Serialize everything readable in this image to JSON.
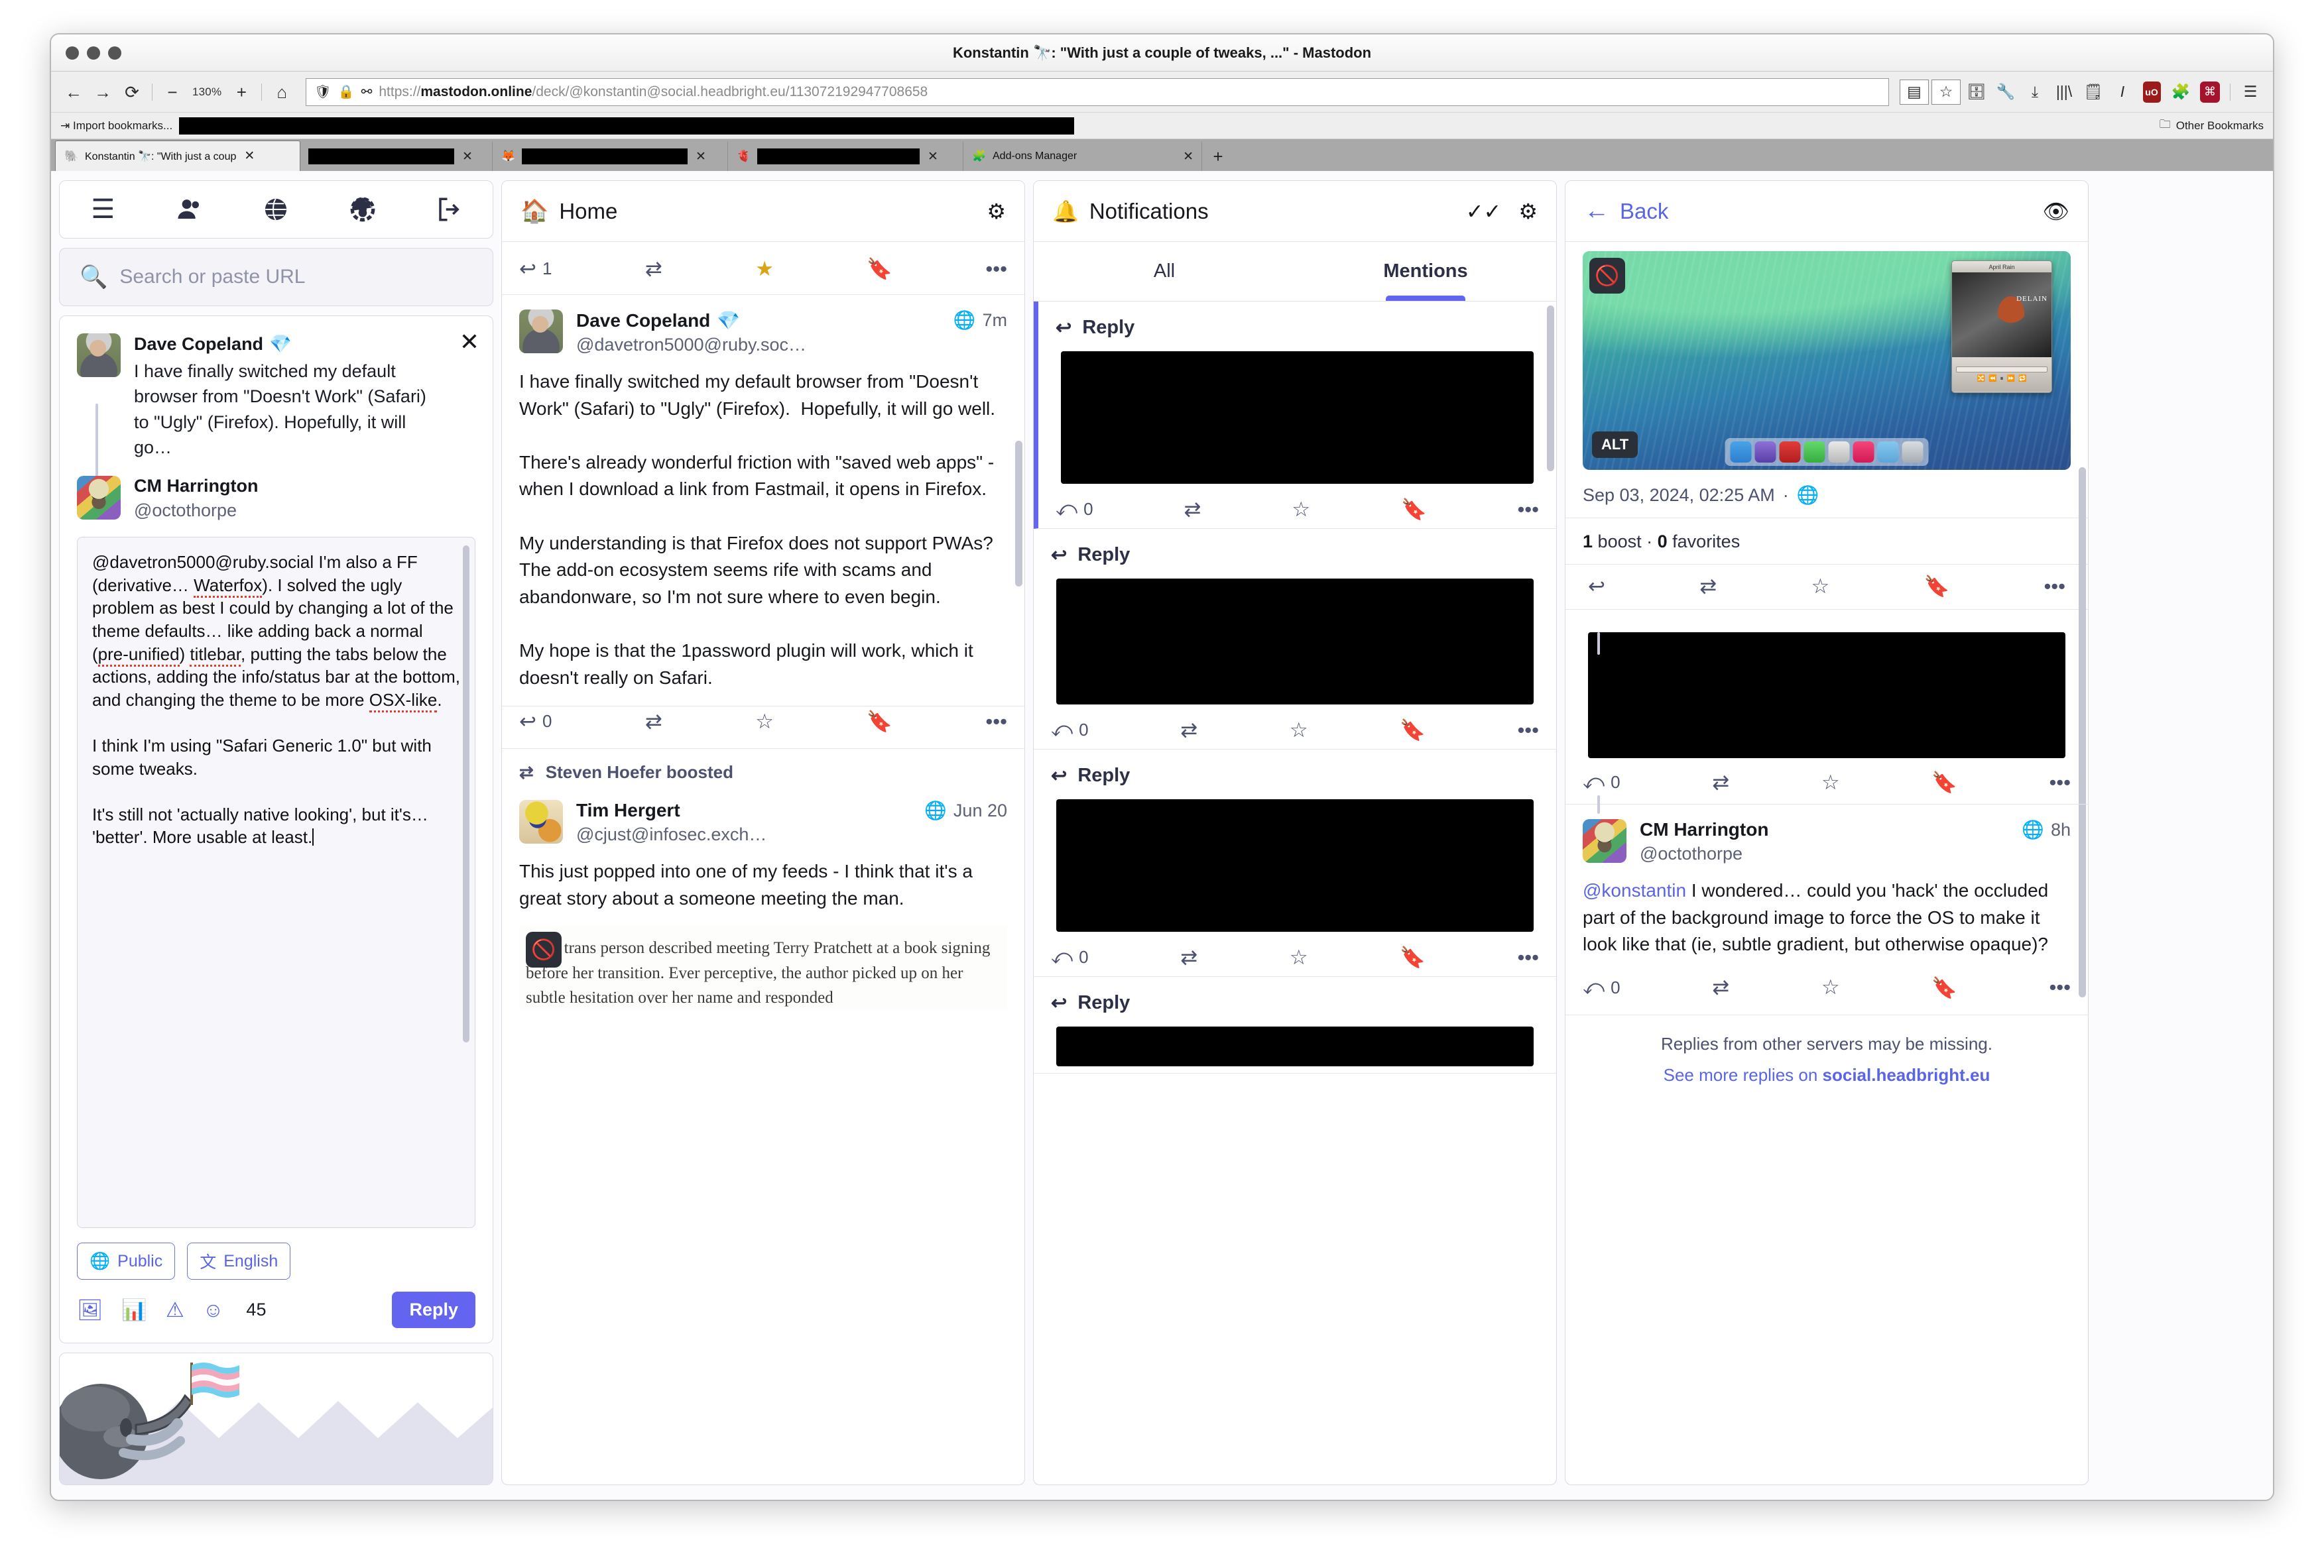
{
  "window": {
    "title": "Konstantin 🔭: \"With just a couple of tweaks, ...\" - Mastodon"
  },
  "browser": {
    "zoom": "130%",
    "url_scheme": "https://",
    "url_domain": "mastodon.online",
    "url_path": "/deck/@konstantin@social.headbright.eu/113072192947708658",
    "bookmarks_import": "Import bookmarks...",
    "other_bookmarks": "Other Bookmarks",
    "tabs": [
      {
        "label": "Konstantin 🔭: \"With just a coup",
        "favicon": "mastodon-icon",
        "active": true,
        "redacted": false
      },
      {
        "label": "",
        "favicon": "blank-icon",
        "active": false,
        "redacted": true
      },
      {
        "label": "",
        "favicon": "firefox-icon",
        "active": false,
        "redacted": true
      },
      {
        "label": "",
        "favicon": "heart-icon",
        "active": false,
        "redacted": true
      },
      {
        "label": "Add-ons Manager",
        "favicon": "addons-icon",
        "active": false,
        "redacted": false
      }
    ],
    "nav_icons": [
      "back-icon",
      "forward-icon",
      "reload-icon",
      "zoom-out-icon",
      "zoom-in-icon",
      "home-icon"
    ],
    "url_icons": [
      "shield-icon",
      "lock-icon",
      "permissions-icon"
    ],
    "toolbar_icons": [
      "reader-mode-icon",
      "bookmark-star-icon",
      "save-page-icon",
      "wrench-icon",
      "downloads-icon",
      "library-icon",
      "annotate-icon",
      "italic-icon",
      "ublock-origin-icon",
      "addons-icon",
      "command-key-icon",
      "app-menu-icon"
    ]
  },
  "sidebar": {
    "nav_icons": [
      "hamburger-menu-icon",
      "people-icon",
      "globe-icon",
      "gear-icon",
      "logout-icon"
    ],
    "search": {
      "placeholder": "Search or paste URL",
      "icon": "search-icon"
    },
    "thread_preview": [
      {
        "name": "Dave Copeland",
        "emoji": "💎",
        "handle": "",
        "body": "I have finally switched my default browser from \"Doesn't Work\" (Safari) to \"Ugly\" (Firefox).  Hopefully, it will go…",
        "avatar": "av-dave"
      },
      {
        "name": "CM Harrington",
        "emoji": "",
        "handle": "@octothorpe",
        "body": "",
        "avatar": "av-cm"
      }
    ],
    "close_label": "✕",
    "compose": {
      "text_part1": "@davetron5000@ruby.social I'm also a FF (derivative… ",
      "sp1": "Waterfox",
      "text_part2": "). I solved the ugly problem as best I could by changing a lot of the theme defaults… like adding back a normal (",
      "sp2": "pre-unified",
      "text_part3": ") ",
      "sp3": "titlebar",
      "text_part4": ", putting the tabs below the actions, adding the info/status bar at the bottom, and changing the theme to be more ",
      "sp4": "OSX-like",
      "text_part5": ".\n\nI think I'm using \"Safari Generic 1.0\" but with some tweaks.\n\nIt's still not 'actually native looking', but it's… 'better'. More usable at least.",
      "visibility": "Public",
      "visibility_icon": "globe-icon",
      "language": "English",
      "language_icon": "translate-icon",
      "action_icons": [
        "add-media-icon",
        "add-poll-icon",
        "content-warning-icon",
        "emoji-picker-icon"
      ],
      "char_count": "45",
      "submit_label": "Reply"
    }
  },
  "home_column": {
    "title": "Home",
    "title_icon": "home-icon",
    "settings_icon": "gear-icon",
    "pinned_actionbar": {
      "reply_count": "1",
      "icons": [
        "reply-icon",
        "boost-icon",
        "favourite-star-icon",
        "bookmark-icon",
        "more-icon"
      ],
      "favourited": true
    },
    "posts": [
      {
        "name": "Dave Copeland",
        "emoji": "💎",
        "handle": "@davetron5000@ruby.soc…",
        "time": "7m",
        "visibility_icon": "globe-icon",
        "avatar": "av-dave",
        "body": "I have finally switched my default browser from \"Doesn't Work\" (Safari) to \"Ugly\" (Firefox).  Hopefully, it will go well.\n\nThere's already wonderful friction with \"saved web apps\" - when I download a link from Fastmail, it opens in Firefox.\n\nMy understanding is that Firefox does not support PWAs?  The add-on ecosystem seems rife with scams and abandonware, so I'm not sure where to even begin.\n\nMy hope is that the 1password plugin will work, which it doesn't really on Safari.",
        "reply_count": "0",
        "boosted_by": null
      },
      {
        "name": "Tim Hergert",
        "emoji": "",
        "handle": "@cjust@infosec.exch…",
        "time": "Jun 20",
        "visibility_icon": "globe-icon",
        "avatar": "av-tim",
        "body": "This just popped into one of my feeds - I think that it's a great story about a someone meeting the man.",
        "reply_count": "",
        "boosted_by": "Steven Hoefer boosted",
        "attachment_text": "other trans person described meeting Terry Pratchett at a book signing before her transition. Ever perceptive, the author picked up on her subtle hesitation over her name and responded",
        "attachment_hidden_icon": "eye-off-icon"
      }
    ]
  },
  "notifications_column": {
    "title": "Notifications",
    "title_icon": "bell-icon",
    "mark_read_icon": "double-check-icon",
    "settings_icon": "gear-icon",
    "tabs": [
      {
        "label": "All",
        "active": false
      },
      {
        "label": "Mentions",
        "active": true
      }
    ],
    "items": [
      {
        "label": "Reply",
        "icon": "reply-icon",
        "unread": true,
        "reply_count": "0",
        "redacted": true
      },
      {
        "label": "Reply",
        "icon": "reply-icon",
        "unread": false,
        "reply_count": "0",
        "redacted": true
      },
      {
        "label": "Reply",
        "icon": "reply-icon",
        "unread": false,
        "reply_count": "0",
        "redacted": true
      },
      {
        "label": "Reply",
        "icon": "reply-icon",
        "unread": false,
        "reply_count": "",
        "redacted": true
      }
    ],
    "action_icons": [
      "reply-all-icon",
      "boost-icon",
      "favourite-star-icon",
      "bookmark-icon",
      "more-icon"
    ]
  },
  "detail_column": {
    "back_label": "Back",
    "back_icon": "arrow-left-icon",
    "visibility_eye_icon": "eye-icon",
    "media": {
      "alt_badge": "ALT",
      "hidden_icon": "eye-off-icon",
      "player_title": "April Rain",
      "player_artist": "DELAIN",
      "player_elapsed": "0:12",
      "player_remaining": "-4:23",
      "dock_icons": [
        "finder-icon",
        "sketch-icon",
        "vivaldi-icon",
        "messages-icon",
        "pause-app-icon",
        "music-icon",
        "folder-icon",
        "trash-icon"
      ]
    },
    "timestamp": "Sep 03, 2024, 02:25 AM",
    "timestamp_visibility_icon": "globe-icon",
    "boost_count": "1",
    "boost_label": "boost",
    "favorite_count": "0",
    "favorite_label": "favorites",
    "action_icons": [
      "reply-icon",
      "boost-icon",
      "favourite-star-icon",
      "bookmark-icon",
      "more-icon"
    ],
    "redacted_reply": {
      "reply_count": "0"
    },
    "reply_post": {
      "name": "CM Harrington",
      "handle": "@octothorpe",
      "time": "8h",
      "visibility_icon": "globe-icon",
      "mention": "@konstantin",
      "body": " I wondered… could you 'hack' the occluded part of the background image to force the OS to make it look like that (ie, subtle gradient, but otherwise opaque)?",
      "reply_count": "0"
    },
    "footer_note": "Replies from other servers may be missing.",
    "footer_link_prefix": "See more replies on ",
    "footer_link_domain": "social.headbright.eu"
  },
  "colors": {
    "accent": "#6364f0",
    "link": "#5a65e6",
    "star_active": "#d9a514",
    "muted_text": "#5d6176"
  }
}
